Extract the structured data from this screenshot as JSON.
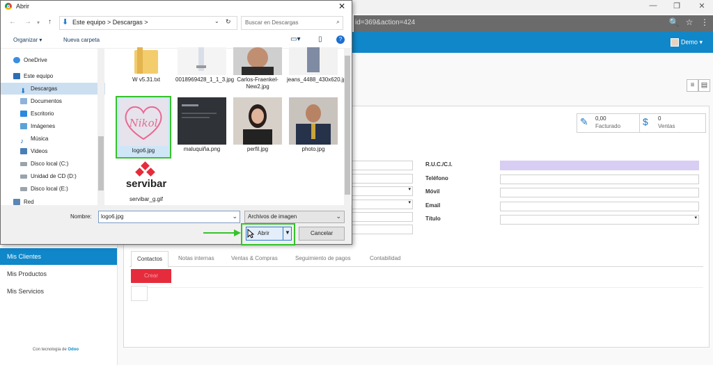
{
  "browser": {
    "url_fragment": "id=369&action=424",
    "window_controls": [
      "—",
      "❐",
      "✕"
    ]
  },
  "app": {
    "user_name": "Demo",
    "sidebar": [
      {
        "label": "Mis Clientes",
        "active": true
      },
      {
        "label": "Mis Productos",
        "active": false
      },
      {
        "label": "Mis Servicios",
        "active": false
      }
    ],
    "powered_prefix": "Con tecnología de",
    "powered_brand": "Odoo",
    "stat_buttons": [
      {
        "value": "0,00",
        "label": "Facturado",
        "icon": "edit-icon"
      },
      {
        "value": "0",
        "label": "Ventas",
        "icon": "dollar-icon"
      }
    ],
    "form_labels": [
      "R.U.C./C.I.",
      "Teléfono",
      "Móvil",
      "Email",
      "Título"
    ],
    "tabs": [
      "Contactos",
      "Notas internas",
      "Ventas & Compras",
      "Seguimiento de pagos",
      "Contabilidad"
    ],
    "create_button": "Crear",
    "colors": {
      "header": "#0f87c9",
      "create": "#e52c3c",
      "highlight": "#35c32a",
      "ruc_field": "#d8cdf3"
    }
  },
  "dialog": {
    "title": "Abrir",
    "breadcrumb": "Este equipo  >  Descargas  >",
    "search_placeholder": "Buscar en Descargas",
    "organize_label": "Organizar ▾",
    "new_folder_label": "Nueva carpeta",
    "nav_items": [
      {
        "label": "OneDrive",
        "icon": "cloud-icon"
      },
      {
        "label": "Este equipo",
        "icon": "computer-icon"
      },
      {
        "label": "Descargas",
        "icon": "downloads-icon",
        "selected": true
      },
      {
        "label": "Documentos",
        "icon": "documents-icon"
      },
      {
        "label": "Escritorio",
        "icon": "desktop-icon"
      },
      {
        "label": "Imágenes",
        "icon": "images-icon"
      },
      {
        "label": "Música",
        "icon": "music-icon"
      },
      {
        "label": "Videos",
        "icon": "videos-icon"
      },
      {
        "label": "Disco local (C:)",
        "icon": "drive-icon"
      },
      {
        "label": "Unidad de CD (D:)",
        "icon": "cd-drive-icon"
      },
      {
        "label": "Disco local (E:)",
        "icon": "drive-icon"
      },
      {
        "label": "Red",
        "icon": "network-icon"
      }
    ],
    "files": [
      {
        "name": "W v5.31.txt",
        "kind": "folder"
      },
      {
        "name": "0018969428_1_1_3.jpg",
        "kind": "photo-model"
      },
      {
        "name": "Carlos-Fraenkel-New2.jpg",
        "kind": "photo-man"
      },
      {
        "name": "jeans_4488_430x620.jpg",
        "kind": "photo-jeans"
      },
      {
        "name": "logo6.jpg",
        "kind": "logo-nikol",
        "selected": true,
        "logo_text": "Nikol"
      },
      {
        "name": "maluquiña.png",
        "kind": "dark-screen"
      },
      {
        "name": "perfil.jpg",
        "kind": "photo-woman"
      },
      {
        "name": "photo.jpg",
        "kind": "photo-suit"
      },
      {
        "name": "servibar_g.gif",
        "kind": "logo-servibar",
        "logo_text": "servibar"
      }
    ],
    "filename_label": "Nombre:",
    "filename_value": "logo6.jpg",
    "filter_value": "Archivos de imagen",
    "open_label": "Abrir",
    "cancel_label": "Cancelar"
  }
}
